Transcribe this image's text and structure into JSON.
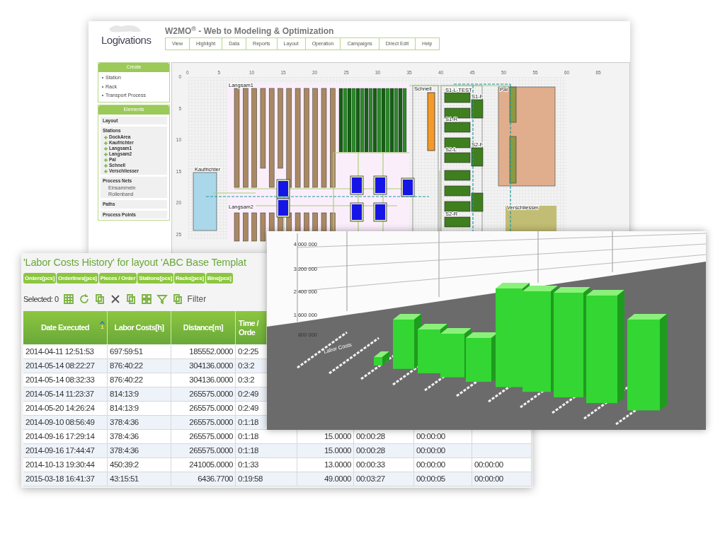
{
  "app_window": {
    "logo": "Logivations",
    "title": "W2MO$^{®}$ - Web to Modeling & Optimization",
    "menu": [
      "View",
      "Highlight",
      "Data",
      "Reports",
      "Layout",
      "Operation",
      "Campaigns",
      "Direct Edit",
      "Help"
    ],
    "create_panel": {
      "title": "Create",
      "items": [
        "Station",
        "Rack",
        "Transport Process"
      ]
    },
    "elements_panel": {
      "title": "Elements",
      "sections": [
        {
          "title": "Layout"
        },
        {
          "title": "Stations",
          "items": [
            {
              "label": "DockArea",
              "kind": "station"
            },
            {
              "label": "Kaufrichter",
              "kind": "station"
            },
            {
              "label": "Langsam1",
              "kind": "station"
            },
            {
              "label": "Langsam2",
              "kind": "station"
            },
            {
              "label": "Pal",
              "kind": "station"
            },
            {
              "label": "Schnell",
              "kind": "station"
            },
            {
              "label": "Verschliesser",
              "kind": "station"
            }
          ]
        },
        {
          "title": "Process Nets",
          "items": [
            {
              "label": "Einsammeln",
              "kind": "net"
            },
            {
              "label": "Rollenband",
              "kind": "net"
            }
          ]
        },
        {
          "title": "Paths"
        },
        {
          "title": "Process Points"
        }
      ]
    },
    "layout_canvas": {
      "x_ruler": [
        "0",
        "5",
        "10",
        "15",
        "20",
        "25",
        "30",
        "35",
        "40",
        "45",
        "50",
        "55",
        "60",
        "65"
      ],
      "y_ruler": [
        "0",
        "5",
        "10",
        "15",
        "20",
        "25"
      ],
      "labels": [
        "Langsam1",
        "Kaufrichter",
        "Langsam2",
        "Schnell",
        "S1-L-TEST",
        "S1-F",
        "S1-R",
        "S2-L",
        "S2-F",
        "S2-R",
        "Pal",
        "Verschliesser"
      ]
    }
  },
  "table_window": {
    "title": "'Labor Costs History' for layout 'ABC Base Templat",
    "tabs": [
      "Orders[pcs]",
      "Orderlines[pcs]",
      "Pieces / Order",
      "Stations[pcs]",
      "Racks[pcs]",
      "Bins[pcs]"
    ],
    "selected_count": "Selected: 0",
    "filter": "Filter",
    "columns": [
      {
        "label": "Date Executed",
        "sort": "1"
      },
      {
        "label": "Labor Costs[h]"
      },
      {
        "label": "Distance[m]"
      },
      {
        "label": "Time / Orde"
      }
    ],
    "rows": [
      [
        "2014-04-11 12:51:53",
        "697:59:51",
        "185552.0000",
        "0:2:25"
      ],
      [
        "2014-05-14 08:22:27",
        "876:40:22",
        "304136.0000",
        "0:3:2"
      ],
      [
        "2014-05-14 08:32:33",
        "876:40:22",
        "304136.0000",
        "0:3:2"
      ],
      [
        "2014-05-14 11:23:37",
        "814:13:9",
        "265575.0000",
        "0:2:49"
      ],
      [
        "2014-05-20 14:26:24",
        "814:13:9",
        "265575.0000",
        "0:2:49"
      ],
      [
        "2014-09-10 08:56:49",
        "378:4:36",
        "265575.0000",
        "0:1:18"
      ],
      [
        "2014-09-16 17:29:14",
        "378:4:36",
        "265575.0000",
        "0:1:18",
        "15.0000",
        "00:00:28",
        "00:00:00"
      ],
      [
        "2014-09-16 17:44:47",
        "378:4:36",
        "265575.0000",
        "0:1:18",
        "15.0000",
        "00:00:28",
        "00:00:00"
      ],
      [
        "2014-10-13 19:30:44",
        "450:39:2",
        "241005.0000",
        "0:1:33",
        "13.0000",
        "00:00:33",
        "00:00:00",
        "00:00:00"
      ],
      [
        "2015-03-18 16:41:37",
        "43:15:51",
        "6436.7700",
        "0:19:58",
        "49.0000",
        "00:03:27",
        "00:00:05",
        "00:00:00"
      ]
    ]
  },
  "chart_window": {
    "y_labels": [
      "4 000 000",
      "3 200 000",
      "2 400 000",
      "1 600 000",
      "800 000"
    ],
    "axis_label": "Labor Costs"
  }
}
